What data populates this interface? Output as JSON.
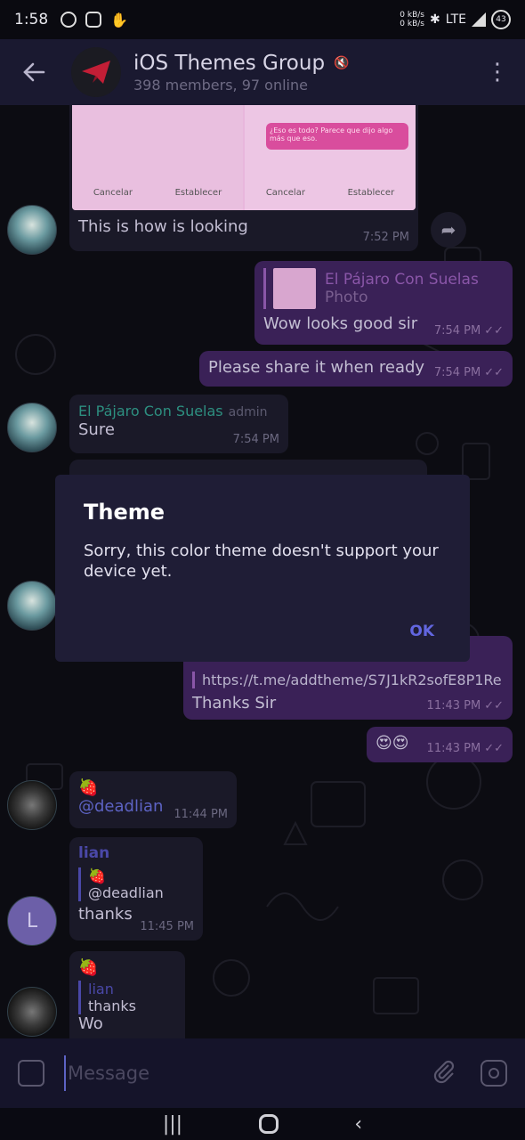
{
  "status_bar": {
    "time": "1:58",
    "net_up": "0 kB/s",
    "net_down": "0 kB/s",
    "network": "LTE",
    "battery": "43"
  },
  "header": {
    "title": "iOS Themes Group",
    "subtitle": "398 members, 97 online"
  },
  "screenshot": {
    "left_cancel": "Cancelar",
    "left_set": "Establecer",
    "right_cancel": "Cancelar",
    "right_set": "Establecer",
    "pink_text": "¿Eso es todo? Parece que dijo algo más que eso."
  },
  "messages": {
    "m1": {
      "text": "This is how is looking",
      "time": "7:52 PM"
    },
    "m2": {
      "reply_name": "El Pájaro Con Suelas",
      "reply_text": "Photo",
      "text": "Wow looks good sir",
      "time": "7:54 PM"
    },
    "m3": {
      "text": "Please share it when ready",
      "time": "7:54 PM"
    },
    "m4": {
      "sender": "El Pájaro Con Suelas",
      "badge": "admin",
      "text": "Sure",
      "time": "7:54 PM"
    },
    "m5": {
      "link": "https://t.me/addtheme/S7J1kR2sofE8P1Re",
      "text": "Thanks Sir",
      "time": "11:43 PM"
    },
    "m6": {
      "text": "😍😍",
      "time": "11:43 PM"
    },
    "m7": {
      "emoji": "🍓",
      "mention": "@deadlian",
      "time": "11:44 PM"
    },
    "m8": {
      "sender": "lian",
      "quote_emoji": "🍓",
      "quote_text": "@deadlian",
      "text": "thanks",
      "time": "11:45 PM"
    },
    "m9": {
      "emoji": "🍓",
      "quote_name": "lian",
      "quote_text": "thanks",
      "text": "Wo"
    }
  },
  "avatar_letter": "L",
  "dialog": {
    "title": "Theme",
    "text": "Sorry, this color theme doesn't support your device yet.",
    "ok": "OK"
  },
  "composer": {
    "placeholder": "Message"
  },
  "colors": {
    "accent": "#6266e0",
    "out_bubble": "#3a2157",
    "in_bubble": "#1a1928"
  }
}
